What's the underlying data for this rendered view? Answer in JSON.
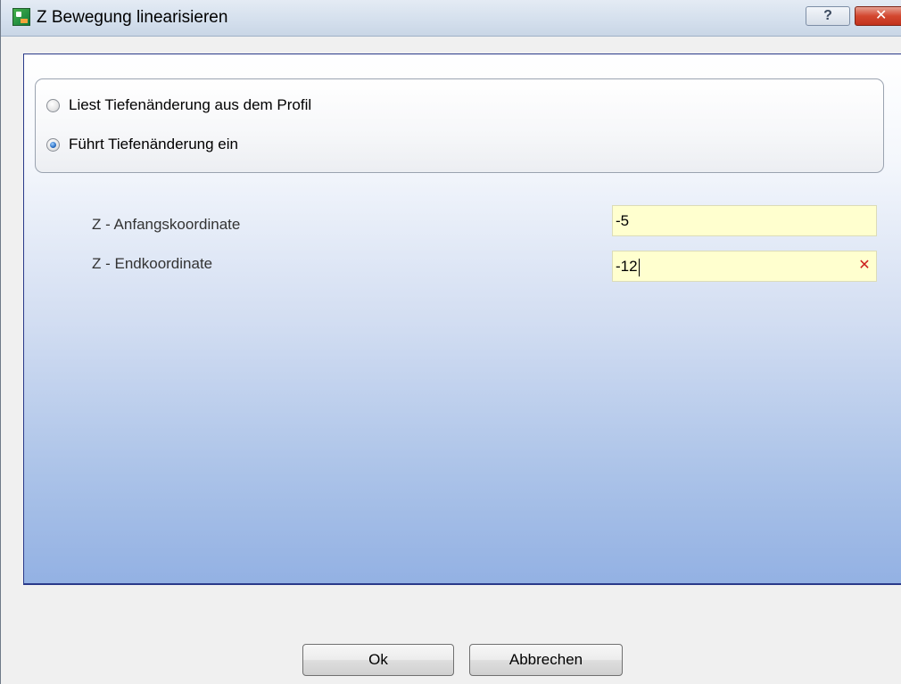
{
  "window": {
    "title": "Z Bewegung linearisieren",
    "help_label": "?",
    "close_label": "✕"
  },
  "depth_mode": {
    "options": [
      {
        "label": "Liest Tiefenänderung aus dem Profil",
        "checked": false
      },
      {
        "label": "Führt Tiefenänderung ein",
        "checked": true
      }
    ]
  },
  "fields": {
    "start": {
      "label": "Z - Anfangskoordinate",
      "value": "-5"
    },
    "end": {
      "label": "Z - Endkoordinate",
      "value": "-12",
      "clear_label": "✕"
    }
  },
  "buttons": {
    "ok": "Ok",
    "cancel": "Abbrechen"
  },
  "colors": {
    "field_background": "#ffffcf",
    "panel_border": "#2a3a8a",
    "clear_icon": "#cc1f1f"
  }
}
